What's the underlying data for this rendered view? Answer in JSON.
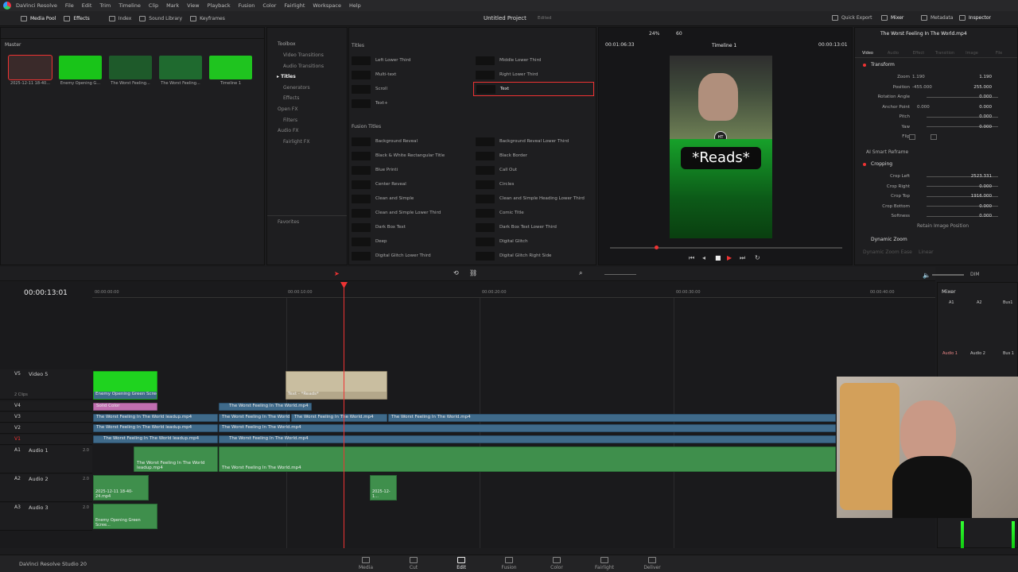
{
  "menu": [
    "DaVinci Resolve",
    "File",
    "Edit",
    "Trim",
    "Timeline",
    "Clip",
    "Mark",
    "View",
    "Playback",
    "Fusion",
    "Color",
    "Fairlight",
    "Workspace",
    "Help"
  ],
  "toolbar": {
    "media_pool": "Media Pool",
    "effects": "Effects",
    "index": "Index",
    "sound_library": "Sound Library",
    "keyframes": "Keyframes",
    "project_title": "Untitled Project",
    "project_status": "Edited",
    "quick_export": "Quick Export",
    "mixer": "Mixer",
    "metadata": "Metadata",
    "inspector": "Inspector"
  },
  "media_pool": {
    "bin": "Master",
    "clips": [
      {
        "name": "2025-12-11 18-40...",
        "color": "#3a2a2a"
      },
      {
        "name": "Enemy Opening G...",
        "color": "#19c419"
      },
      {
        "name": "The Worst Feeling...",
        "color": "#1e5a2a"
      },
      {
        "name": "The Worst Feeling...",
        "color": "#1f6a2f"
      },
      {
        "name": "Timeline 1",
        "color": "#1fc41f"
      }
    ]
  },
  "effects_tree": {
    "toolbox": "Toolbox",
    "items": [
      "Video Transitions",
      "Audio Transitions",
      "Titles",
      "Generators",
      "Effects"
    ],
    "open_fx": "Open FX",
    "filters": "Filters",
    "audio_fx": "Audio FX",
    "fairlight_fx": "Fairlight FX",
    "favorites": "Favorites"
  },
  "titles": {
    "heading": "Titles",
    "left": [
      "Left Lower Third",
      "Multi-text",
      "Scroll",
      "Text+"
    ],
    "right": [
      "Middle Lower Third",
      "Right Lower Third",
      "Text"
    ]
  },
  "fusion_titles": {
    "heading": "Fusion Titles",
    "left": [
      "Background Reveal",
      "Black & White Rectangular Title",
      "Blue Printi",
      "Center Reveal",
      "Clean and Simple",
      "Clean and Simple Lower Third",
      "Dark Box Text",
      "Deep",
      "Digital Glitch Lower Third"
    ],
    "right": [
      "Background Reveal Lower Third",
      "Black Border",
      "Call Out",
      "Circles",
      "Clean and Simple Heading Lower Third",
      "Comic Title",
      "Dark Box Text Lower Third",
      "Digital Glitch",
      "Digital Glitch Right Side"
    ]
  },
  "viewer": {
    "zoom": "24%",
    "fps": "60",
    "timeline_name": "Timeline 1",
    "src_tc": "00:01:06:33",
    "tc": "00:00:13:01",
    "caption": "*Reads*",
    "watermark": "HT"
  },
  "inspector": {
    "clip_name": "The Worst Feeling In The World.mp4",
    "tabs": [
      "Video",
      "Audio",
      "Effect",
      "Transition",
      "Image",
      "File"
    ],
    "transform": "Transform",
    "zoom_label": "Zoom",
    "zoom_x": "1.190",
    "zoom_y": "1.190",
    "position_label": "Position",
    "pos_x": "-455.000",
    "pos_y": "255.000",
    "rotation_label": "Rotation Angle",
    "rotation": "0.000",
    "anchor_label": "Anchor Point",
    "anchor_x": "0.000",
    "anchor_y": "0.000",
    "pitch_label": "Pitch",
    "pitch": "0.000",
    "yaw_label": "Yaw",
    "yaw": "0.000",
    "flip_label": "Flip",
    "ai_reframe": "AI Smart Reframe",
    "cropping": "Cropping",
    "crop_left_label": "Crop Left",
    "crop_left": "2523.331",
    "crop_right_label": "Crop Right",
    "crop_right": "0.000",
    "crop_top_label": "Crop Top",
    "crop_top": "1916.000",
    "crop_bottom_label": "Crop Bottom",
    "crop_bottom": "0.000",
    "softness_label": "Softness",
    "softness": "0.000",
    "retain": "Retain Image Position",
    "dynamic_zoom": "Dynamic Zoom",
    "dz_ease": "Dynamic Zoom Ease",
    "dz_linear": "Linear"
  },
  "timeline": {
    "timecode": "00:00:13:01",
    "ruler": [
      "00:00:00:00",
      "00:00:10:00",
      "00:00:20:00",
      "00:00:30:00",
      "00:00:40:00"
    ],
    "tracks": {
      "v5": "Video 5",
      "v5_sub": "2 Clips",
      "v4": "V4",
      "v3": "V3",
      "v2": "V2",
      "v1": "V1",
      "a1": "Audio 1",
      "a2": "Audio 2",
      "a3": "Audio 3",
      "a1_id": "A1",
      "a2_id": "A2",
      "a3_id": "A3",
      "v5_id": "V5",
      "a_level": "2.0"
    },
    "clips": {
      "enemy": "Enemy Opening Green Scree...",
      "text": "Text - *Reads*",
      "solid": "Solid Color",
      "wf": "The Worst Feeling In The World.mp4",
      "wf_leadup": "The Worst Feeling In The World leadup.mp4",
      "wf_short": "The Worst Feeling In The World...",
      "rec": "2025-12-11 18-40-24.mp4",
      "rec_short": "2025-12-1...",
      "enemy_a": "Enemy Opening Green Scree..."
    }
  },
  "mixer": {
    "title": "Mixer",
    "cols": [
      "A1",
      "A2",
      "Bus1"
    ],
    "names": [
      "Audio 1",
      "Audio 2",
      "Bus 1"
    ],
    "dim": "DIM"
  },
  "footer": {
    "brand": "DaVinci Resolve Studio 20",
    "pages": [
      "Media",
      "Cut",
      "Edit",
      "Fusion",
      "Color",
      "Fairlight",
      "Deliver"
    ]
  }
}
